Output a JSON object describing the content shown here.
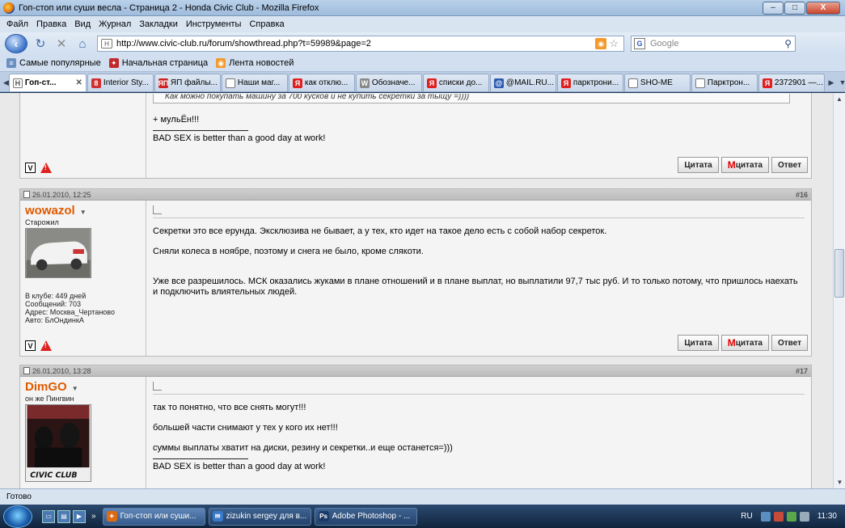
{
  "window": {
    "title": "Гоп-стоп или суши весла - Страница 2 - Honda Civic Club - Mozilla Firefox",
    "min": "–",
    "max": "□",
    "close": "X"
  },
  "menu": [
    "Файл",
    "Правка",
    "Вид",
    "Журнал",
    "Закладки",
    "Инструменты",
    "Справка"
  ],
  "nav": {
    "url": "http://www.civic-club.ru/forum/showthread.php?t=59989&page=2",
    "search_placeholder": "Google"
  },
  "bookmarks": [
    "Самые популярные",
    "Начальная страница",
    "Лента новостей"
  ],
  "tabs": [
    {
      "label": "Гоп-ст...",
      "icon": "H",
      "color": "#ffffff",
      "active": true
    },
    {
      "label": "Interior Sty...",
      "icon": "8",
      "color": "#d03030"
    },
    {
      "label": "ЯП файлы...",
      "icon": "ЯП",
      "color": "#d02020"
    },
    {
      "label": "Наши маг...",
      "icon": "",
      "color": "#ffffff"
    },
    {
      "label": "как отклю...",
      "icon": "Я",
      "color": "#e02020"
    },
    {
      "label": "Обозначе...",
      "icon": "W",
      "color": "#888888"
    },
    {
      "label": "списки до...",
      "icon": "Я",
      "color": "#e02020"
    },
    {
      "label": "@MAIL.RU...",
      "icon": "@",
      "color": "#2a5ab0"
    },
    {
      "label": "парктрони...",
      "icon": "Я",
      "color": "#e02020"
    },
    {
      "label": "SHO-ME",
      "icon": "",
      "color": "#ffffff"
    },
    {
      "label": "Парктрон...",
      "icon": "",
      "color": "#ffffff"
    },
    {
      "label": "2372901 —...",
      "icon": "Я",
      "color": "#e02020"
    }
  ],
  "post15": {
    "quote": "Как можно покупать машину за 700 кусков и не купить секретки за тыщу =))))",
    "line1": "+ мульЁн!!!",
    "signature": "BAD SEX is better than a good day at work!"
  },
  "post16": {
    "date": "26.01.2010, 12:25",
    "number": "#16",
    "username": "wowazol",
    "usertitle": "Старожил",
    "stats": [
      "В клубе: 449 дней",
      "Сообщений: 703",
      "Адрес: Москва_Чертаново",
      "Авто: БлОндинкА"
    ],
    "p1": "Секретки это все ерунда. Эксклюзива не бывает, а у тех, кто идет на такое дело есть с собой набор секреток.",
    "p2": "Сняли колеса в ноябре, поэтому и снега не было, кроме слякоти.",
    "p3": "Уже все разрешилось. МСК оказались жуками в плане отношений и в плане выплат, но выплатили 97,7 тыс руб. И то только потому, что пришлось наехать и подключить влиятельных людей."
  },
  "post17": {
    "date": "26.01.2010, 13:28",
    "number": "#17",
    "username": "DimGO",
    "usertitle": "он же Пингвин",
    "p1": "так то понятно, что все снять могут!!!",
    "p2": "большей части снимают у тех у кого их нет!!!",
    "p3": "суммы выплаты хватит на диски, резину и секретки..и еще останется=)))",
    "signature": "BAD SEX is better than a good day at work!",
    "avatar_text": "CIVIC CLUB"
  },
  "buttons": {
    "quote": "Цитата",
    "mquote_m": "М",
    "mquote": "цитата",
    "reply": "Ответ"
  },
  "icons": {
    "vk": "V"
  },
  "status": "Готово",
  "taskbar": {
    "tasks": [
      "Гоп-стоп или суши...",
      "zizukin sergey для в...",
      "Adobe Photoshop - ..."
    ],
    "lang": "RU",
    "clock": "11:30"
  }
}
